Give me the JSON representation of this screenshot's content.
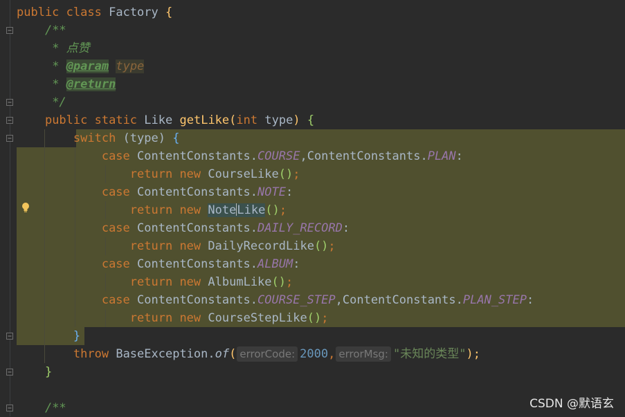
{
  "editor": {
    "lines": {
      "l1": {
        "kw1": "public",
        "kw2": "class",
        "name": "Factory",
        "brace": "{"
      },
      "l2": {
        "text": "/**"
      },
      "l3": {
        "star": "* ",
        "text": "点赞"
      },
      "l4": {
        "star": "* ",
        "tag": "@param",
        "value": "type"
      },
      "l5": {
        "star": "* ",
        "tag": "@return"
      },
      "l6": {
        "text": "*/"
      },
      "l7": {
        "kw1": "public",
        "kw2": "static",
        "type": "Like",
        "fn": "getLike",
        "open": "(",
        "kw3": "int",
        "param": "type",
        "close": ")",
        "brace": "{"
      },
      "l8": {
        "kw": "switch",
        "expr": "(type)",
        "brace": "{"
      },
      "l9": {
        "kw": "case",
        "cls1": "ContentConstants.",
        "c1": "COURSE",
        "sep": ",",
        "cls2": "ContentConstants.",
        "c2": "PLAN",
        "colon": ":"
      },
      "l10": {
        "kw1": "return",
        "kw2": "new",
        "name": "CourseLike",
        "parens": "()",
        "semi": ";"
      },
      "l11": {
        "kw": "case",
        "cls1": "ContentConstants.",
        "c1": "NOTE",
        "colon": ":"
      },
      "l12": {
        "kw1": "return",
        "kw2": "new",
        "name_a": "Not",
        "name_b": "e",
        "name_c": "Like",
        "parens": "()",
        "semi": ";"
      },
      "l13": {
        "kw": "case",
        "cls1": "ContentConstants.",
        "c1": "DAILY_RECORD",
        "colon": ":"
      },
      "l14": {
        "kw1": "return",
        "kw2": "new",
        "name": "DailyRecordLike",
        "parens": "()",
        "semi": ";"
      },
      "l15": {
        "kw": "case",
        "cls1": "ContentConstants.",
        "c1": "ALBUM",
        "colon": ":"
      },
      "l16": {
        "kw1": "return",
        "kw2": "new",
        "name": "AlbumLike",
        "parens": "()",
        "semi": ";"
      },
      "l17": {
        "kw": "case",
        "cls1": "ContentConstants.",
        "c1": "COURSE_STEP",
        "sep": ",",
        "cls2": "ContentConstants.",
        "c2": "PLAN_STEP",
        "colon": ":"
      },
      "l18": {
        "kw1": "return",
        "kw2": "new",
        "name": "CourseStepLike",
        "parens": "()",
        "semi": ";"
      },
      "l19": {
        "text": "}"
      },
      "l20": {
        "kw": "throw",
        "cls": "BaseException.",
        "method": "of",
        "open": "(",
        "hint1": "errorCode:",
        "num": "2000",
        "comma": ",",
        "hint2": "errorMsg:",
        "str": "\"未知的类型\"",
        "close": ");"
      },
      "l21": {
        "text": "}"
      },
      "l22": {
        "text": "/**"
      }
    },
    "gutter": {
      "bulb_icon": "lightbulb-icon",
      "fold_icon": "fold-marker-icon"
    }
  },
  "watermark": {
    "text": "CSDN @默语玄"
  },
  "colors": {
    "background": "#2b2b2b",
    "keyword": "#cc7832",
    "function": "#ffc66d",
    "comment": "#629755",
    "constant": "#9876aa",
    "number": "#6897bb",
    "string": "#6a8759",
    "highlight": "#50502f"
  }
}
